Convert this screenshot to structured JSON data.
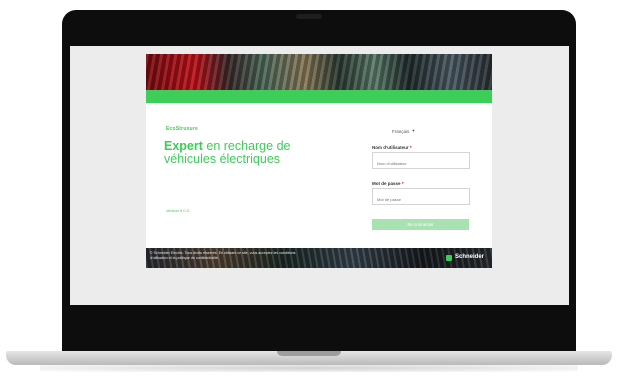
{
  "page": {
    "logo": "EcoStruxure",
    "headline_part1": "Expert",
    "headline_part2": " en recharge de véhicules électriques",
    "version": "version 5.0.3",
    "language": "Français",
    "language_caret": "▾",
    "username_label": "Nom d'utilisateur",
    "username_placeholder": "Nom d'utilisateur",
    "password_label": "Mot de passe",
    "password_placeholder": "Mot de passe",
    "required_mark": "*",
    "login_button": "Se connecter",
    "footer_text": "© Schneider Electric. Tous droits réservés. En utilisant ce site, vous acceptez les conditions d'utilisation et la politique de confidentialité.",
    "brand": "Schneider"
  },
  "colors": {
    "accent": "#3dcd58",
    "button_disabled": "#a8e2b1"
  }
}
